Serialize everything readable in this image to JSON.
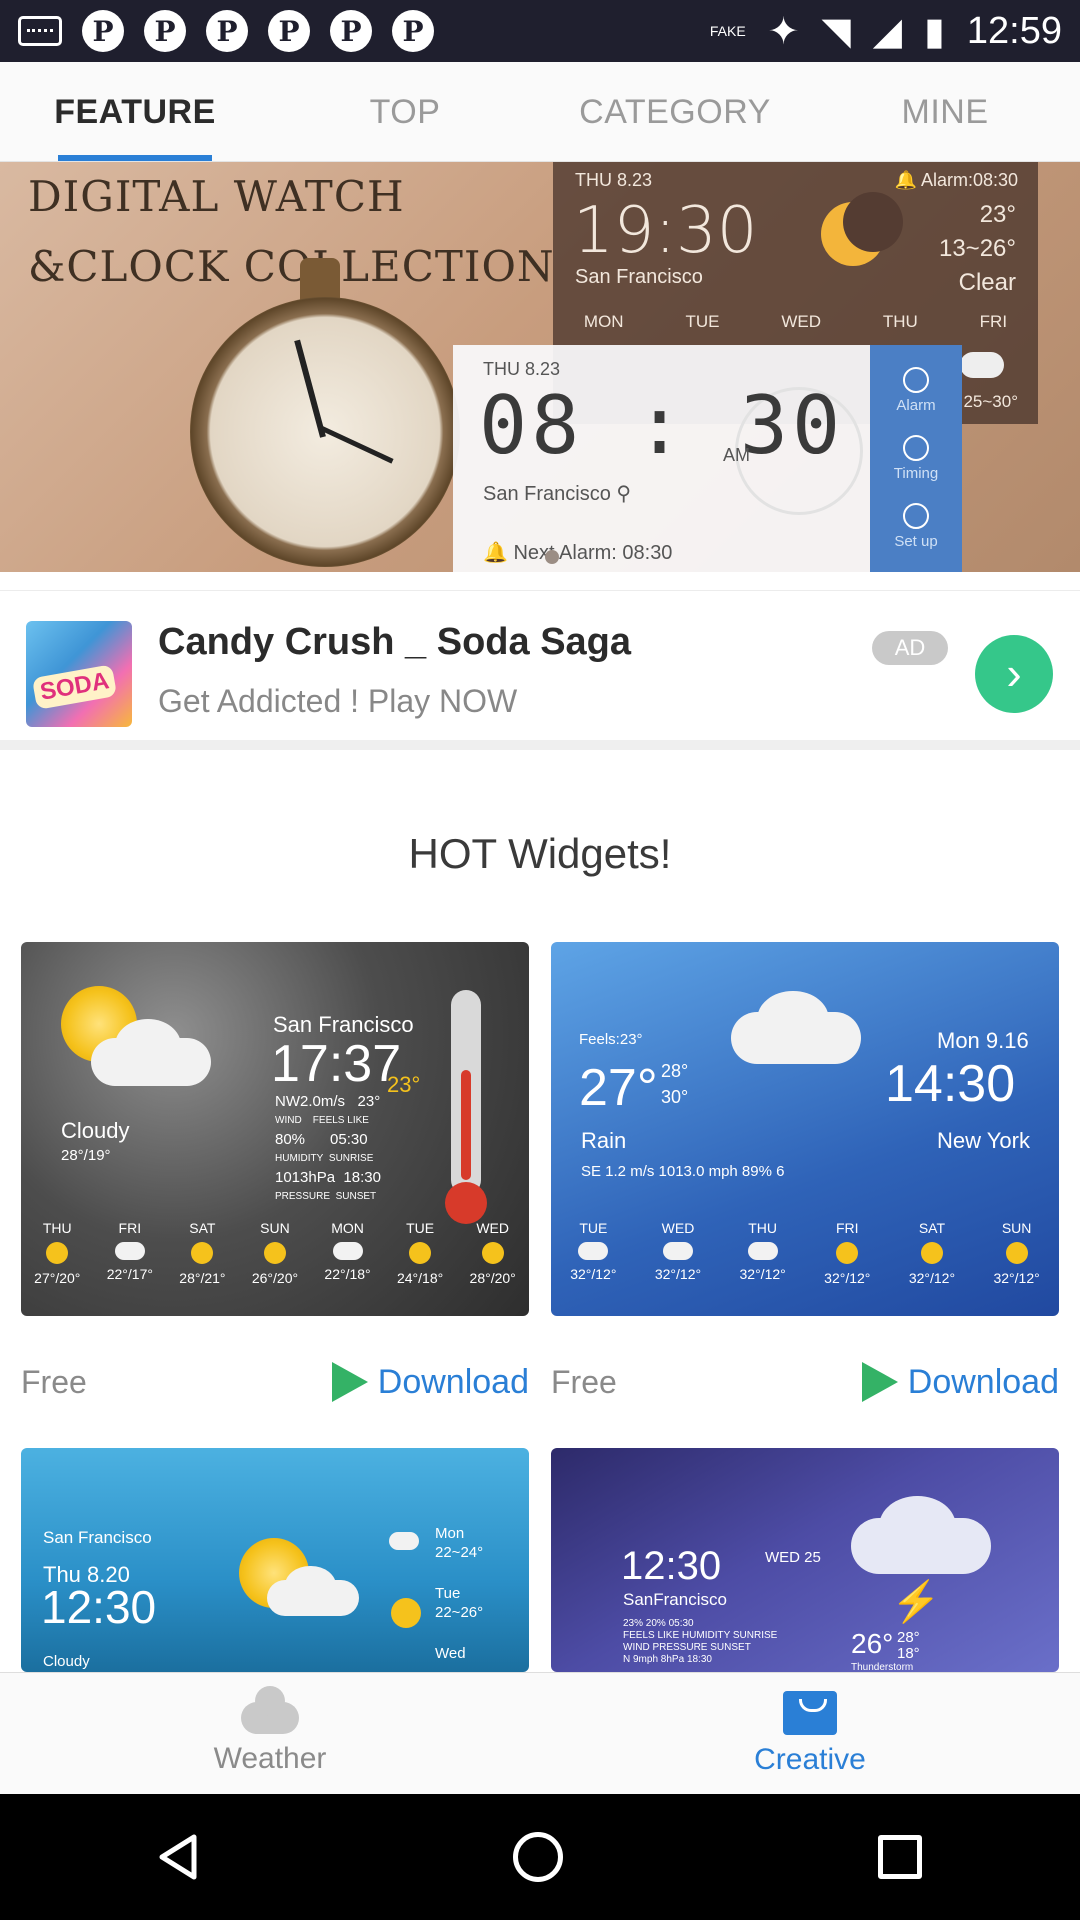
{
  "status_bar": {
    "time": "12:59",
    "fake_label": "FAKE",
    "notification_icons": [
      "pinterest-icon",
      "pinterest-icon",
      "pinterest-icon",
      "pinterest-icon",
      "pinterest-icon",
      "pinterest-icon"
    ],
    "pin_glyph": "P"
  },
  "tabs": [
    {
      "label": "FEATURE",
      "active": true
    },
    {
      "label": "TOP",
      "active": false
    },
    {
      "label": "CATEGORY",
      "active": false
    },
    {
      "label": "MINE",
      "active": false
    }
  ],
  "banner": {
    "title_line1": "DIGITAL WATCH",
    "title_line2": "&CLOCK COLLECTION",
    "dark_widget": {
      "date": "THU 8.23",
      "alarm": "Alarm:08:30",
      "time": "19:30",
      "temp": "23°",
      "range": "13~26°",
      "condition": "Clear",
      "city": "San Francisco",
      "days": [
        "MON",
        "TUE",
        "WED",
        "THU",
        "FRI"
      ],
      "forecast_range": "25~30°"
    },
    "white_widget": {
      "date": "THU 8.23",
      "time": "08 : 30",
      "ampm": "AM",
      "city": "San Francisco",
      "next_alarm": "Next Alarm: 08:30"
    },
    "side_buttons": [
      "Alarm",
      "Timing",
      "Set up"
    ]
  },
  "ad": {
    "icon_text": "SODA",
    "title": "Candy Crush _ Soda Saga",
    "subtitle": "Get Addicted ! Play NOW",
    "badge": "AD",
    "go_glyph": "›"
  },
  "hot_widgets": {
    "title": "HOT Widgets!",
    "cards": [
      {
        "price": "Free",
        "download": "Download",
        "city": "San Francisco",
        "time": "17:37",
        "temp": "23°",
        "condition": "Cloudy",
        "range": "28°/19°",
        "details": [
          "NW2.0m/s",
          "23°",
          "80%",
          "05:30",
          "1013hPa",
          "18:30"
        ],
        "detail_labels": [
          "WIND",
          "FEELS LIKE",
          "HUMIDITY",
          "SUNRISE",
          "PRESSURE",
          "SUNSET"
        ],
        "days": [
          "THU",
          "FRI",
          "SAT",
          "SUN",
          "MON",
          "TUE",
          "WED"
        ],
        "temps": [
          "27°/20°",
          "22°/17°",
          "28°/21°",
          "26°/20°",
          "22°/18°",
          "24°/18°",
          "28°/20°"
        ]
      },
      {
        "price": "Free",
        "download": "Download",
        "feels": "Feels:23°",
        "temp": "27°",
        "hi": "28°",
        "lo": "30°",
        "date": "Mon 9.16",
        "time": "14:30",
        "condition": "Rain",
        "city": "New York",
        "stats": "SE 1.2 m/s   1013.0 mph   89%   6",
        "days": [
          "TUE",
          "WED",
          "THU",
          "FRI",
          "SAT",
          "SUN"
        ],
        "temps": [
          "32°/12°",
          "32°/12°",
          "32°/12°",
          "32°/12°",
          "32°/12°",
          "32°/12°"
        ]
      },
      {
        "city": "San Francisco",
        "date": "Thu 8.20",
        "time": "12:30",
        "condition": "Cloudy",
        "fc": [
          {
            "day": "Mon",
            "range": "22~24°"
          },
          {
            "day": "Tue",
            "range": "22~26°"
          },
          {
            "day": "Wed",
            "range": ""
          }
        ]
      },
      {
        "time": "12:30",
        "date": "WED 25",
        "city": "SanFrancisco",
        "temp": "26°",
        "hi": "28°",
        "lo": "18°",
        "condition": "Thunderstorm",
        "details": [
          "23%",
          "20%",
          "05:30",
          "N 9mph",
          "8hPa",
          "18:30"
        ],
        "detail_labels": [
          "FEELS LIKE",
          "HUMIDITY",
          "SUNRISE",
          "WIND",
          "PRESSURE",
          "SUNSET"
        ]
      }
    ]
  },
  "bottom_nav": [
    {
      "label": "Weather",
      "icon": "cloud-icon",
      "active": false
    },
    {
      "label": "Creative",
      "icon": "shopping-bag-icon",
      "active": true
    }
  ],
  "colors": {
    "accent": "#2a7fd6",
    "status_bar": "#1f1f2e",
    "ad_go": "#35c78a"
  }
}
